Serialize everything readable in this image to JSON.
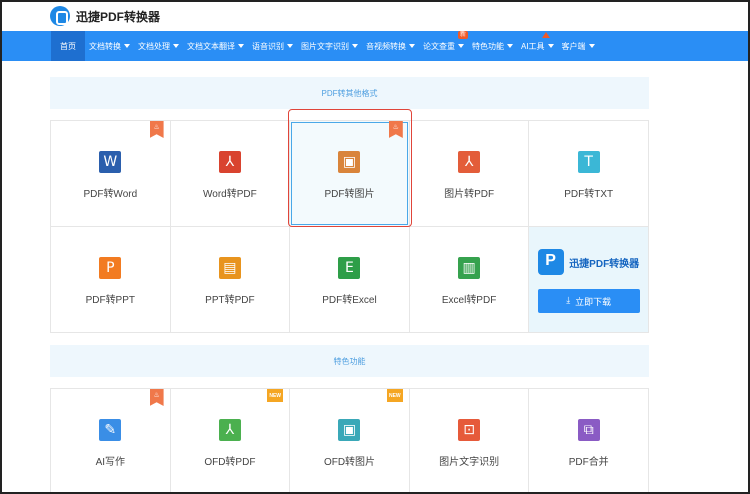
{
  "brand": {
    "name": "迅捷PDF转换器"
  },
  "nav": [
    {
      "label": "首页",
      "active": true,
      "caret": false
    },
    {
      "label": "文档转换",
      "caret": true
    },
    {
      "label": "文档处理",
      "caret": true
    },
    {
      "label": "文档文本翻译",
      "caret": true
    },
    {
      "label": "语音识别",
      "caret": true
    },
    {
      "label": "图片文字识别",
      "caret": true
    },
    {
      "label": "音视频转换",
      "caret": true
    },
    {
      "label": "论文查重",
      "caret": true,
      "badge": "新"
    },
    {
      "label": "特色功能",
      "caret": true
    },
    {
      "label": "AI工具",
      "caret": true,
      "triangle": true
    },
    {
      "label": "客户端",
      "caret": true
    }
  ],
  "section1": {
    "title": "PDF转其他格式"
  },
  "section2": {
    "title": "特色功能"
  },
  "row1": [
    {
      "label": "PDF转Word",
      "icon": "word-icon",
      "glyph": "W",
      "color": "#2b5fad",
      "tag": "fire"
    },
    {
      "label": "Word转PDF",
      "icon": "pdf-icon",
      "glyph": "⅄",
      "color": "#d9432f"
    },
    {
      "label": "PDF转图片",
      "icon": "image-icon",
      "glyph": "▣",
      "color": "#d9843b",
      "tag": "fire",
      "highlight": true
    },
    {
      "label": "图片转PDF",
      "icon": "pdf-icon",
      "glyph": "⅄",
      "color": "#e35d3a"
    },
    {
      "label": "PDF转TXT",
      "icon": "text-icon",
      "glyph": "T",
      "color": "#3bb7d6"
    }
  ],
  "row2": [
    {
      "label": "PDF转PPT",
      "icon": "ppt-icon",
      "glyph": "P",
      "color": "#f27b21"
    },
    {
      "label": "PPT转PDF",
      "icon": "ppt-pdf-icon",
      "glyph": "▤",
      "color": "#e8941e"
    },
    {
      "label": "PDF转Excel",
      "icon": "excel-icon",
      "glyph": "E",
      "color": "#2e9e48"
    },
    {
      "label": "Excel转PDF",
      "icon": "excel-pdf-icon",
      "glyph": "▥",
      "color": "#36a24e"
    }
  ],
  "promo": {
    "name": "迅捷PDF转换器",
    "button": "立即下载",
    "arrow": "⤓"
  },
  "row3": [
    {
      "label": "AI写作",
      "icon": "edit-icon",
      "glyph": "✎",
      "color": "#3a8ee6",
      "tag": "fire"
    },
    {
      "label": "OFD转PDF",
      "icon": "pdf-icon",
      "glyph": "⅄",
      "color": "#4bb04f",
      "tag": "NEW"
    },
    {
      "label": "OFD转图片",
      "icon": "image-icon",
      "glyph": "▣",
      "color": "#3aa8b8",
      "tag": "NEW"
    },
    {
      "label": "图片文字识别",
      "icon": "ocr-icon",
      "glyph": "⊡",
      "color": "#e65a3a"
    },
    {
      "label": "PDF合并",
      "icon": "merge-icon",
      "glyph": "⧉",
      "color": "#8a5bc4"
    }
  ],
  "tag_glyph_fire": "♨"
}
